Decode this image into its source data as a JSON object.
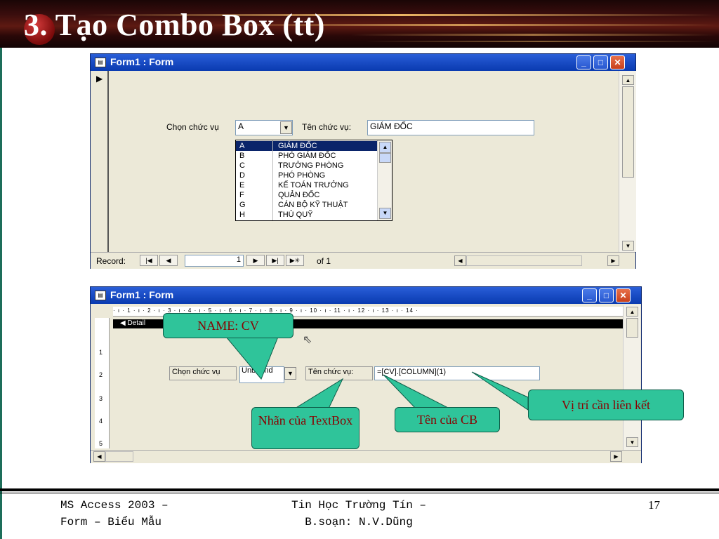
{
  "slide": {
    "bullet": "3.",
    "title": "Tạo Combo Box (tt)"
  },
  "window1": {
    "title": "Form1 : Form",
    "choose_label": "Chọn chức vụ",
    "combo_value": "A",
    "name_label": "Tên chức vụ:",
    "name_value": "GIÁM ĐỐC",
    "dropdown_items": [
      {
        "code": "A",
        "name": "GIÁM ĐỐC"
      },
      {
        "code": "B",
        "name": "PHÓ GIÁM ĐỐC"
      },
      {
        "code": "C",
        "name": "TRƯỞNG PHÒNG"
      },
      {
        "code": "D",
        "name": "PHÓ PHÒNG"
      },
      {
        "code": "E",
        "name": "KẾ TOÁN TRƯỞNG"
      },
      {
        "code": "F",
        "name": "QUẢN ĐỐC"
      },
      {
        "code": "G",
        "name": "CÁN BỘ KỸ THUẬT"
      },
      {
        "code": "H",
        "name": "THỦ QUỸ"
      }
    ],
    "record_label": "Record:",
    "record_value": "1",
    "of_label": "of",
    "total": "1"
  },
  "window2": {
    "title": "Form1 : Form",
    "ruler": "· ı · 1 · ı · 2 · ı · 3 · ı · 4 · ı · 5 · ı · 6 · ı · 7 · ı · 8 · ı · 9 · ı · 10 · ı · 11 · ı · 12 · ı · 13 · ı · 14 ·",
    "vruler": [
      "1",
      "2",
      "3",
      "4",
      "5"
    ],
    "section": "Detail",
    "choose_label": "Chọn chức vụ",
    "combo_value": "Unbound",
    "name_label": "Tên chức vụ:",
    "formula": "=[CV].[COLUMN](1)"
  },
  "callouts": {
    "name_cv": "NAME: CV",
    "textbox_label": "Nhãn của TextBox",
    "cb_name": "Tên của CB",
    "link_position": "Vị trí cần liên kết"
  },
  "footer": {
    "left": "MS Access 2003 – Form – Biểu Mẫu",
    "center": "Tin Học Trường Tín – B.soạn: N.V.Dũng",
    "page": "17"
  },
  "colors": {
    "callout_fill": "#2fc49a",
    "callout_text": "#8a0000",
    "titlebar": "#1c4fc8",
    "selection": "#0a246a"
  }
}
